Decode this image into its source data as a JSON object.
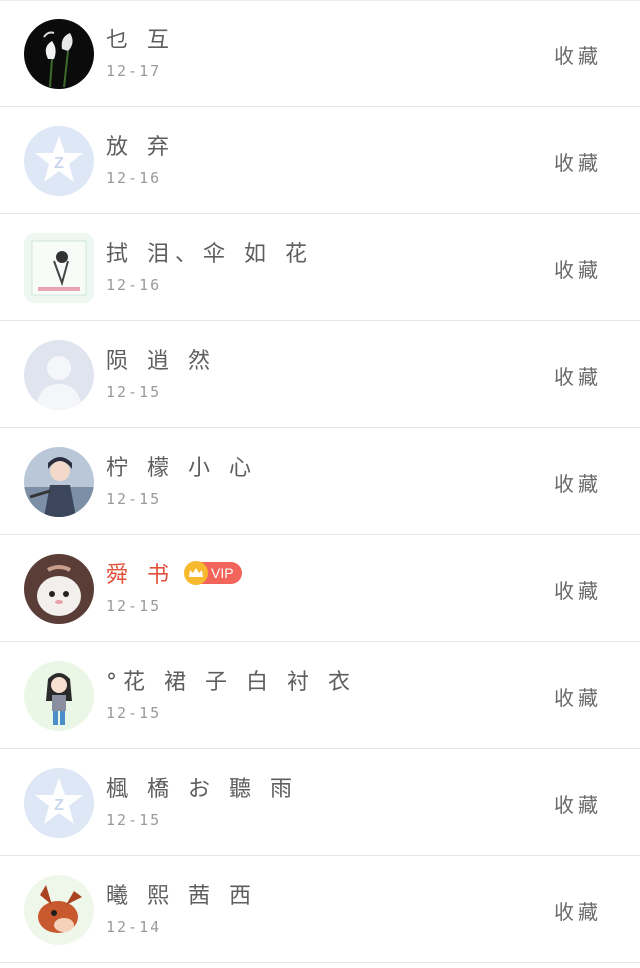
{
  "collect_label": "收藏",
  "vip_label": "VIP",
  "contacts": [
    {
      "name": "乜 互",
      "date": "12-17",
      "avatar": "flower-avatar",
      "vip": false
    },
    {
      "name": "放 弃",
      "date": "12-16",
      "avatar": "qq-default-avatar",
      "vip": false
    },
    {
      "name": "拭 泪、伞 如 花",
      "date": "12-16",
      "avatar": "sketch-avatar",
      "vip": false
    },
    {
      "name": "陨 逍 然",
      "date": "12-15",
      "avatar": "blank-person-avatar",
      "vip": false
    },
    {
      "name": "柠 檬 小 心",
      "date": "12-15",
      "avatar": "anime-boy-avatar",
      "vip": false
    },
    {
      "name": "舜 书",
      "date": "12-15",
      "avatar": "white-cat-avatar",
      "vip": true
    },
    {
      "name": "°花 裙 子 白 衬 衣",
      "date": "12-15",
      "avatar": "cartoon-girl-avatar",
      "vip": false
    },
    {
      "name": "楓 橋 お 聽 雨",
      "date": "12-15",
      "avatar": "qq-default-avatar",
      "vip": false
    },
    {
      "name": "曦 熙 茜 西",
      "date": "12-14",
      "avatar": "cartoon-dog-avatar",
      "vip": false
    }
  ],
  "colors": {
    "vip_name": "#e0503a",
    "vip_badge": "#f3645a",
    "crown": "#f7b92e",
    "divider": "#e6e6e6",
    "text": "#5e5e5e"
  }
}
